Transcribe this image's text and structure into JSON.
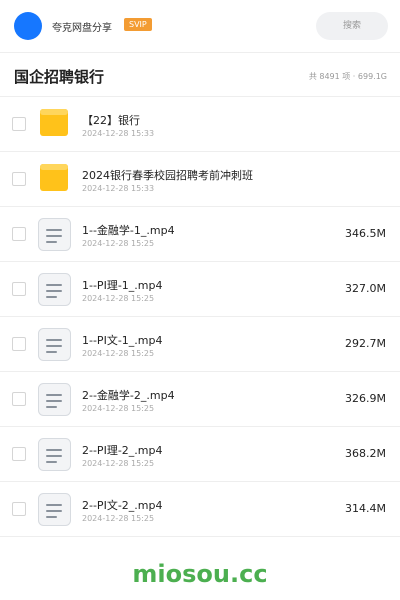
{
  "header": {
    "username": "夸克网盘分享",
    "vip_label": "SVIP",
    "search_label": "搜索"
  },
  "folder": {
    "title": "国企招聘银行",
    "stats": "共 8491 项 · 699.1G"
  },
  "files": [
    {
      "type": "folder",
      "name": "【22】银行",
      "date": "2024-12-28 15:33",
      "size": ""
    },
    {
      "type": "folder",
      "name": "2024银行春季校园招聘考前冲刺班",
      "date": "2024-12-28 15:33",
      "size": ""
    },
    {
      "type": "file",
      "name": "1--金融学-1_.mp4",
      "date": "2024-12-28 15:25",
      "size": "346.5M"
    },
    {
      "type": "file",
      "name": "1--PI理-1_.mp4",
      "date": "2024-12-28 15:25",
      "size": "327.0M"
    },
    {
      "type": "file",
      "name": "1--PI文-1_.mp4",
      "date": "2024-12-28 15:25",
      "size": "292.7M"
    },
    {
      "type": "file",
      "name": "2--金融学-2_.mp4",
      "date": "2024-12-28 15:25",
      "size": "326.9M"
    },
    {
      "type": "file",
      "name": "2--PI理-2_.mp4",
      "date": "2024-12-28 15:25",
      "size": "368.2M"
    },
    {
      "type": "file",
      "name": "2--PI文-2_.mp4",
      "date": "2024-12-28 15:25",
      "size": "314.4M"
    }
  ],
  "watermark": "miosou.cc",
  "colors": {
    "accent": "#1677ff",
    "vip": "#f39c33",
    "folder": "#ffc21a",
    "watermark": "#4caf50"
  },
  "icons": {
    "folder": "folder-icon",
    "file": "document-icon"
  }
}
